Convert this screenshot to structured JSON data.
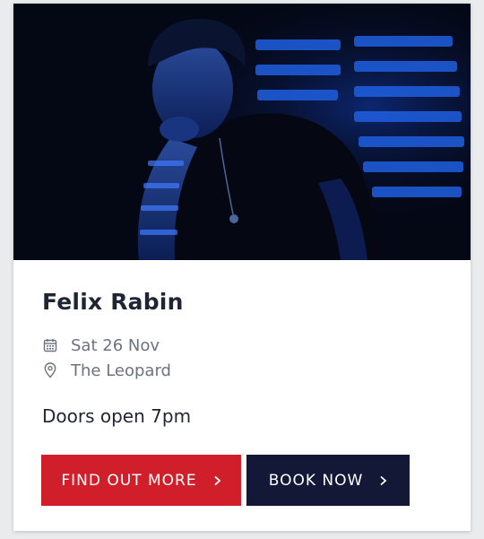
{
  "event": {
    "title": "Felix Rabin",
    "date": "Sat 26 Nov",
    "venue": "The Leopard",
    "doors": "Doors open 7pm"
  },
  "icons": {
    "date": "calendar-icon",
    "venue": "map-pin-icon",
    "button_chevron": "chevron-right-icon"
  },
  "buttons": {
    "find_out_more": "FIND OUT MORE",
    "book_now": "BOOK NOW"
  },
  "colors": {
    "primary_button": "#d01f2a",
    "secondary_button": "#131836",
    "title_text": "#1f2633",
    "meta_text": "#6b7280"
  }
}
